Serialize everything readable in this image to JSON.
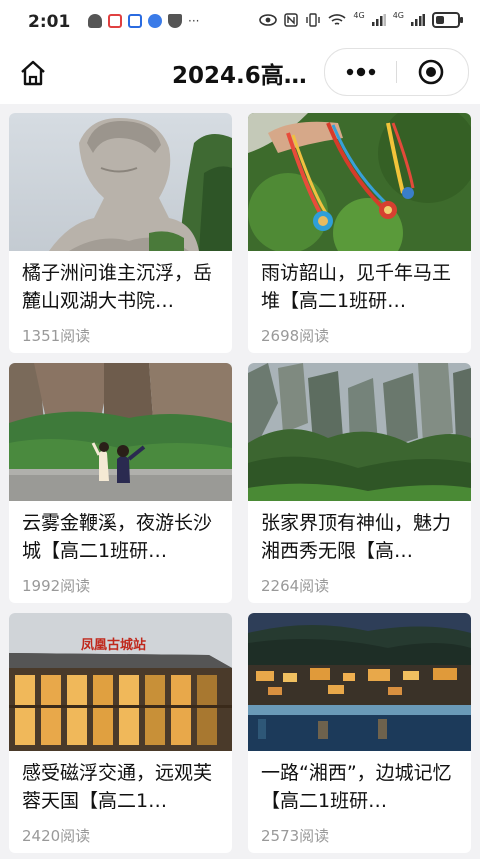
{
  "status_bar": {
    "time": "2:01",
    "dots": "···",
    "signal_label_1": "4G",
    "signal_label_2": "4G"
  },
  "nav": {
    "title": "2024.6高…",
    "home_icon": "home-icon",
    "more_icon": "more-dots-icon",
    "close_icon": "target-close-icon"
  },
  "articles": [
    {
      "title": "橘子洲问谁主沉浮，岳麓山观湖大书院…",
      "reads": "1351阅读"
    },
    {
      "title": "雨访韶山，见千年马王堆【高二1班研…",
      "reads": "2698阅读"
    },
    {
      "title": "云雾金鞭溪，夜游长沙城【高二1班研…",
      "reads": "1992阅读"
    },
    {
      "title": "张家界顶有神仙，魅力湘西秀无限【高…",
      "reads": "2264阅读"
    },
    {
      "title": "感受磁浮交通，远观芙蓉天国【高二1…",
      "reads": "2420阅读"
    },
    {
      "title": "一路“湘西”，边城记忆【高二1班研…",
      "reads": "2573阅读"
    }
  ],
  "images": {
    "sign_text": "凤凰古城站"
  }
}
